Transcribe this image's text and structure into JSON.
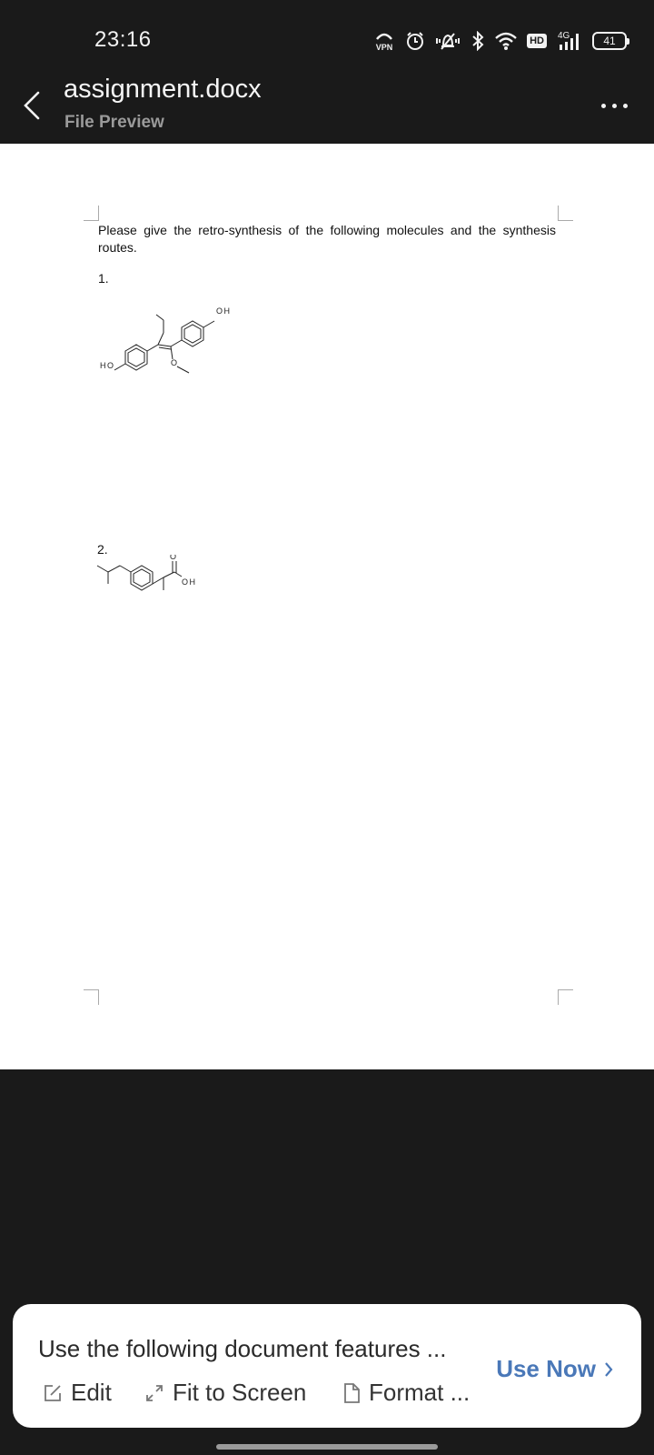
{
  "status_bar": {
    "time": "23:16",
    "icons": [
      "vpn-icon",
      "alarm-icon",
      "vibrate-icon",
      "bluetooth-icon",
      "wifi-icon",
      "hd-icon",
      "signal-4g-icon",
      "battery-icon"
    ],
    "hd": "HD",
    "network": "4G",
    "battery": "41"
  },
  "header": {
    "title": "assignment.docx",
    "subtitle": "File Preview"
  },
  "document": {
    "paragraph": "Please give the retro-synthesis of the following molecules and the synthesis routes.",
    "item1": "1.",
    "item2": "2.",
    "mol1_labels": {
      "oh": "OH",
      "ho": "HO",
      "o": "O"
    },
    "mol2_labels": {
      "o": "O",
      "oh": "OH"
    }
  },
  "feature_card": {
    "title": "Use the following document features ...",
    "use_now": "Use Now",
    "actions": {
      "edit": "Edit",
      "fit": "Fit to Screen",
      "format": "Format ..."
    }
  },
  "colors": {
    "background": "#1a1a1a",
    "accent": "#4a78b8"
  }
}
